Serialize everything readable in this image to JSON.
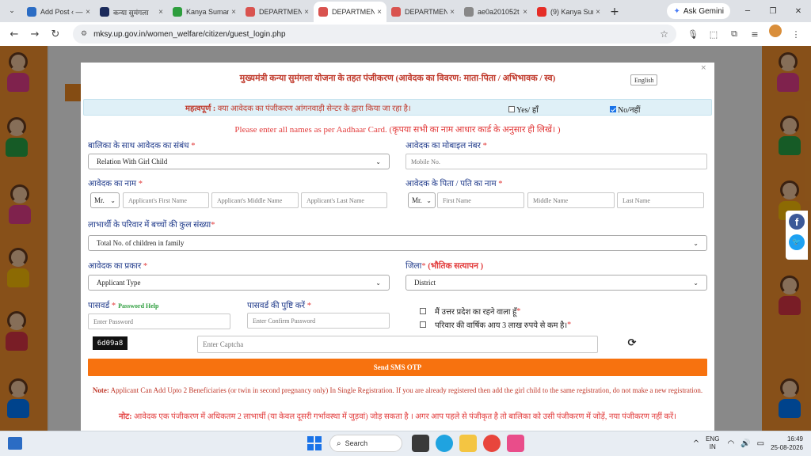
{
  "browser": {
    "tabs": [
      {
        "title": "Add Post ‹ —",
        "color": "#2b6cc4",
        "active": false
      },
      {
        "title": "कन्या सुमंगला",
        "color": "#1b2a5b",
        "active": false
      },
      {
        "title": "Kanya Suman",
        "color": "#2e9e3e",
        "active": false
      },
      {
        "title": "DEPARTMENT",
        "color": "#d9534f",
        "active": false
      },
      {
        "title": "DEPARTMENT",
        "color": "#d9534f",
        "active": true
      },
      {
        "title": "DEPARTMENT",
        "color": "#d9534f",
        "active": false
      },
      {
        "title": "ae0a201052t",
        "color": "#888888",
        "active": false
      },
      {
        "title": "(9) Kanya Sum",
        "color": "#e52d27",
        "active": false
      }
    ],
    "gemini_label": "Ask Gemini",
    "url": "mksy.up.gov.in/women_welfare/citizen/guest_login.php"
  },
  "modal": {
    "title": "मुख्यमंत्री कन्या सुमंगला योजना के तहत पंजीकरण (आवेदक का विवरण: माता-पिता / अभिभावक / स्व)",
    "english_button": "English",
    "close": "×",
    "important_prefix": "महत्वपूर्ण :",
    "important_text": " क्या आवेदक का पंजीकरण आंगनवाड़ी सेन्टर के द्वारा किया जा रहा है।",
    "option_yes": "Yes/ हाँ",
    "option_no": "No/नहीं",
    "yes_checked": false,
    "no_checked": true,
    "aadhaar_note": "Please enter all names as per Aadhaar Card. (कृपया सभी का नाम आधार कार्ड के अनुसार ही लिखें। )",
    "relation": {
      "label": "बालिका के साथ आवेदक का संबंध",
      "value": "Relation With Girl Child"
    },
    "mobile": {
      "label": "आवेदक का मोबाइल नंबर",
      "placeholder": "Mobile No."
    },
    "applicant_name": {
      "label": "आवेदक का नाम",
      "salutation": "Mr.",
      "first": "Applicant's First Name",
      "middle": "Applicant's Middle Name",
      "last": "Applicant's Last Name"
    },
    "father_name": {
      "label": "आवेदक के पिता / पति का नाम",
      "salutation": "Mr.",
      "first": "First Name",
      "middle": "Middle Name",
      "last": "Last Name"
    },
    "children": {
      "label": "लाभार्थी के परिवार में बच्चों की कुल संख्या",
      "value": "Total No. of children in family"
    },
    "applicant_type": {
      "label": "आवेदक का प्रकार",
      "value": "Applicant Type"
    },
    "district": {
      "label": "जिला",
      "label_extra": "(भौतिक सत्यापन )",
      "value": "District"
    },
    "password": {
      "label": "पासवर्ड",
      "help": "Password Help",
      "placeholder": "Enter Password"
    },
    "confirm_password": {
      "label": "पासवर्ड की पुष्टि करें",
      "placeholder": "Enter Confirm Password"
    },
    "declaration_up": "मैं उत्तर प्रदेश का रहने वाला हूँ",
    "declaration_income": "परिवार की वार्षिक आय 3 लाख रुपये से कम है।",
    "captcha_code": "6d09a8",
    "captcha_placeholder": "Enter Captcha",
    "send_button": "Send SMS OTP",
    "note_en_prefix": "Note:",
    "note_en_text": " Applicant Can Add Upto 2 Beneficiaries (or twin in second pregnancy only) In Single Registration. If you are already registered then add the girl child to the same registration, do not make a new registration.",
    "note_hi_prefix": "नोट:",
    "note_hi_text": " आवेदक एक पंजीकरण में अधिकतम 2 लाभार्थी (या केवल दूसरी गर्भावस्था में जुड़वां) जोड़ सकता है । अगर आप पहले से पंजीकृत है तो बालिका को उसी पंजीकरण में जोड़ें, नया पंजीकरण नहीं करें।"
  },
  "taskbar": {
    "search": "Search",
    "lang_1": "ENG",
    "lang_2": "IN",
    "time": "16:49",
    "date": "25-08-2026"
  },
  "colors": {
    "accent_orange": "#f7720f",
    "label_blue": "#1f3a8a",
    "required_red": "#e23b3b"
  }
}
